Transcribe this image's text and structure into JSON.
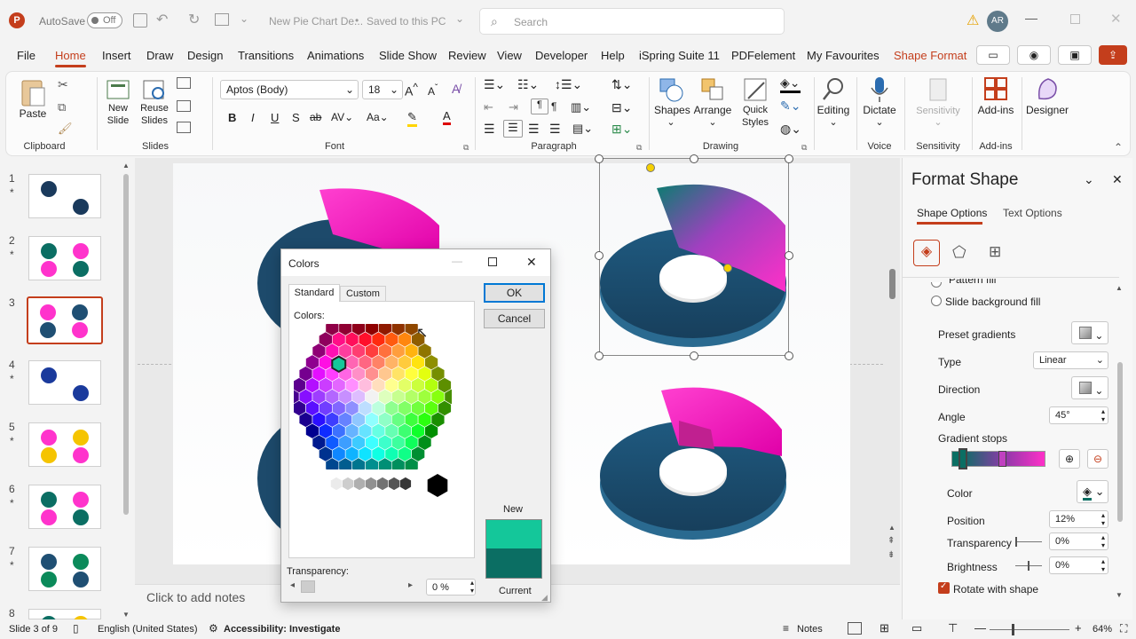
{
  "titlebar": {
    "autosave_label": "AutoSave",
    "autosave_state": "Off",
    "doc_title": "New Pie Chart De...",
    "save_status": "Saved to this PC",
    "search_placeholder": "Search",
    "avatar_initials": "AR"
  },
  "menu": {
    "items": [
      "File",
      "Home",
      "Insert",
      "Draw",
      "Design",
      "Transitions",
      "Animations",
      "Slide Show",
      "Review",
      "View",
      "Developer",
      "Help",
      "iSpring Suite 11",
      "PDFelement",
      "My Favourites",
      "Shape Format"
    ],
    "active": "Home"
  },
  "ribbon": {
    "clipboard": {
      "paste": "Paste",
      "label": "Clipboard"
    },
    "slides": {
      "new_slide": "New Slide",
      "reuse_slides": "Reuse Slides",
      "label": "Slides"
    },
    "font": {
      "family": "Aptos (Body)",
      "size": "18",
      "label": "Font"
    },
    "paragraph": {
      "label": "Paragraph"
    },
    "drawing": {
      "shapes": "Shapes",
      "arrange": "Arrange",
      "quick_styles": "Quick Styles",
      "label": "Drawing"
    },
    "editing": {
      "label": "Editing"
    },
    "voice": {
      "dictate": "Dictate",
      "label": "Voice"
    },
    "sensitivity": {
      "btn": "Sensitivity",
      "label": "Sensitivity"
    },
    "addins": {
      "btn": "Add-ins",
      "label": "Add-ins"
    },
    "designer": {
      "btn": "Designer"
    }
  },
  "thumbnails": [
    {
      "num": "1",
      "star": "*"
    },
    {
      "num": "2",
      "star": "*"
    },
    {
      "num": "3",
      "star": ""
    },
    {
      "num": "4",
      "star": "*"
    },
    {
      "num": "5",
      "star": "*"
    },
    {
      "num": "6",
      "star": "*"
    },
    {
      "num": "7",
      "star": "*"
    },
    {
      "num": "8",
      "star": ""
    }
  ],
  "notes_placeholder": "Click to add notes",
  "status": {
    "slide_info": "Slide 3 of 9",
    "language": "English (United States)",
    "accessibility": "Accessibility: Investigate",
    "notes": "Notes",
    "zoom": "64%"
  },
  "dialog": {
    "title": "Colors",
    "tabs": [
      "Standard",
      "Custom"
    ],
    "colors_label": "Colors:",
    "ok": "OK",
    "cancel": "Cancel",
    "new_label": "New",
    "current_label": "Current",
    "transparency_label": "Transparency:",
    "transparency_value": "0 %",
    "new_color": "#14c79a",
    "current_color": "#0b6e63"
  },
  "panel": {
    "title": "Format Shape",
    "tabs": [
      "Shape Options",
      "Text Options"
    ],
    "pattern_fill": "Pattern fill",
    "slide_bg_fill": "Slide background fill",
    "preset_gradients": "Preset gradients",
    "type_label": "Type",
    "type_value": "Linear",
    "direction_label": "Direction",
    "angle_label": "Angle",
    "angle_value": "45°",
    "gradient_stops": "Gradient stops",
    "color_label": "Color",
    "position_label": "Position",
    "position_value": "12%",
    "transparency_label": "Transparency",
    "transparency_value": "0%",
    "brightness_label": "Brightness",
    "brightness_value": "0%",
    "rotate_with_shape": "Rotate with shape"
  },
  "colors": {
    "accent": "#c43e1c",
    "ring": "#1f4f73",
    "magenta": "#ff33cc",
    "teal": "#0b6e63"
  }
}
